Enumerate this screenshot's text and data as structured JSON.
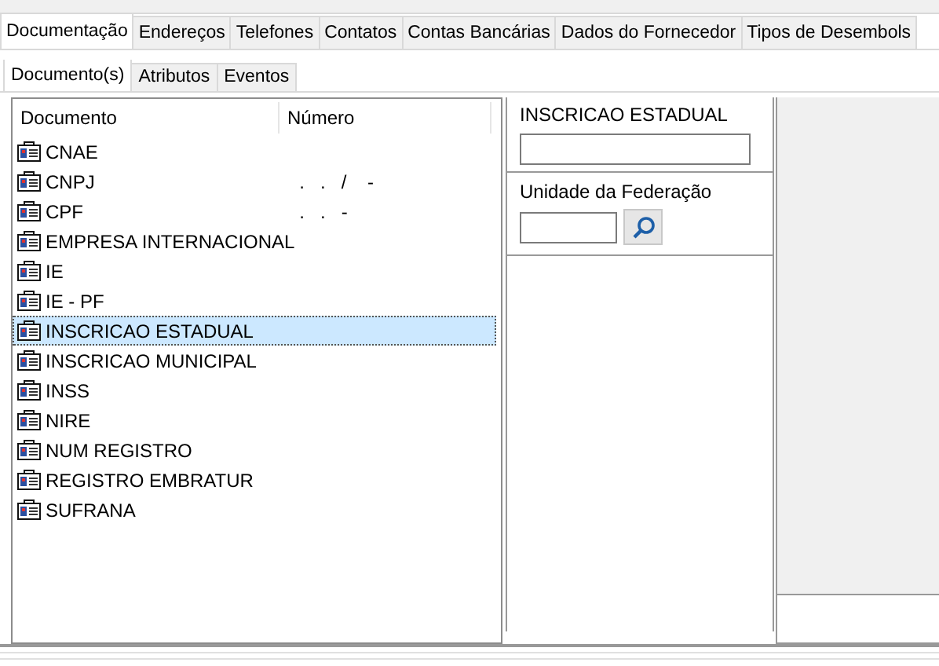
{
  "tabs": [
    {
      "label": "Documentação",
      "selected": true
    },
    {
      "label": "Endereços",
      "selected": false
    },
    {
      "label": "Telefones",
      "selected": false
    },
    {
      "label": "Contatos",
      "selected": false
    },
    {
      "label": "Contas Bancárias",
      "selected": false
    },
    {
      "label": "Dados do Fornecedor",
      "selected": false
    },
    {
      "label": "Tipos de Desembols",
      "selected": false
    }
  ],
  "subtabs": [
    {
      "label": "Documento(s)",
      "selected": true
    },
    {
      "label": "Atributos",
      "selected": false
    },
    {
      "label": "Eventos",
      "selected": false
    }
  ],
  "table": {
    "columns": [
      "Documento",
      "Número"
    ],
    "rows": [
      {
        "documento": "CNAE",
        "numero": "",
        "selected": false
      },
      {
        "documento": "CNPJ",
        "numero": "  .   .   /    -",
        "selected": false
      },
      {
        "documento": "CPF",
        "numero": "  .   .   -",
        "selected": false
      },
      {
        "documento": "EMPRESA INTERNACIONAL",
        "numero": "",
        "selected": false
      },
      {
        "documento": "IE",
        "numero": "",
        "selected": false
      },
      {
        "documento": "IE - PF",
        "numero": "",
        "selected": false
      },
      {
        "documento": "INSCRICAO ESTADUAL",
        "numero": "",
        "selected": true
      },
      {
        "documento": "INSCRICAO MUNICIPAL",
        "numero": "",
        "selected": false
      },
      {
        "documento": "INSS",
        "numero": "",
        "selected": false
      },
      {
        "documento": "NIRE",
        "numero": "",
        "selected": false
      },
      {
        "documento": "NUM REGISTRO",
        "numero": "",
        "selected": false
      },
      {
        "documento": "REGISTRO EMBRATUR",
        "numero": "",
        "selected": false
      },
      {
        "documento": "SUFRANA",
        "numero": "",
        "selected": false
      }
    ]
  },
  "form": {
    "title": "INSCRICAO ESTADUAL",
    "uf_label": "Unidade da Federação"
  }
}
